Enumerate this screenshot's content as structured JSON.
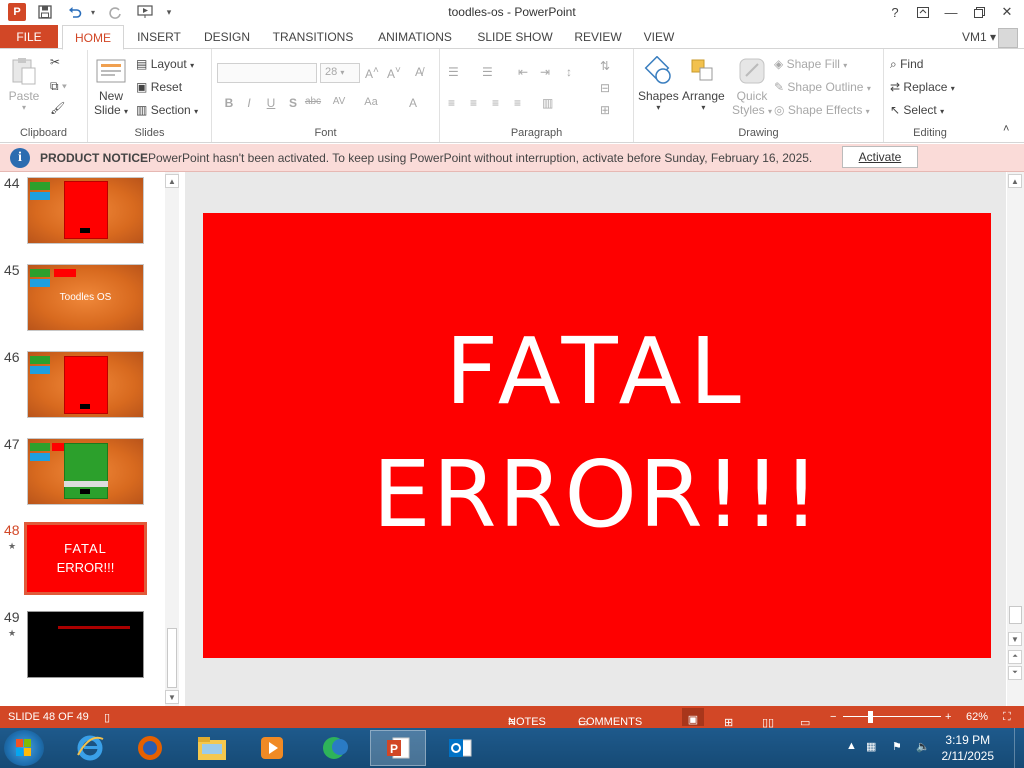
{
  "window": {
    "title": "toodles-os - PowerPoint",
    "help": "?",
    "user": "VM1"
  },
  "tabs": [
    "FILE",
    "HOME",
    "INSERT",
    "DESIGN",
    "TRANSITIONS",
    "ANIMATIONS",
    "SLIDE SHOW",
    "REVIEW",
    "VIEW"
  ],
  "ribbon": {
    "clipboard": {
      "paste": "Paste",
      "label": "Clipboard"
    },
    "slides": {
      "new_slide_1": "New",
      "new_slide_2": "Slide",
      "layout": "Layout",
      "reset": "Reset",
      "section": "Section",
      "label": "Slides"
    },
    "font": {
      "size": "28",
      "label": "Font"
    },
    "paragraph": {
      "label": "Paragraph"
    },
    "drawing": {
      "shapes": "Shapes",
      "arrange": "Arrange",
      "quick_styles_1": "Quick",
      "quick_styles_2": "Styles",
      "shape_fill": "Shape Fill",
      "shape_outline": "Shape Outline",
      "shape_effects": "Shape Effects",
      "label": "Drawing"
    },
    "editing": {
      "find": "Find",
      "replace": "Replace",
      "select": "Select",
      "label": "Editing"
    }
  },
  "notice": {
    "title": "PRODUCT NOTICE",
    "message": "PowerPoint hasn't been activated. To keep using PowerPoint without interruption, activate before Sunday, February 16, 2025.",
    "button": "Activate"
  },
  "thumbnails": [
    {
      "num": "44",
      "text": ""
    },
    {
      "num": "45",
      "text": "Toodles OS"
    },
    {
      "num": "46",
      "text": ""
    },
    {
      "num": "47",
      "text": ""
    },
    {
      "num": "48",
      "text_1": "FATAL",
      "text_2": "ERROR!!!"
    },
    {
      "num": "49",
      "text": ""
    }
  ],
  "slide": {
    "line1": "FATAL",
    "line2": "ERROR!!!",
    "background": "#fe0000"
  },
  "status": {
    "slide_counter": "SLIDE 48 OF 49",
    "notes": "NOTES",
    "comments": "COMMENTS",
    "zoom": "62%"
  },
  "taskbar": {
    "time": "3:19 PM",
    "date": "2/11/2025"
  },
  "colors": {
    "accent": "#d24726",
    "notice_bg": "#fadbd8"
  }
}
